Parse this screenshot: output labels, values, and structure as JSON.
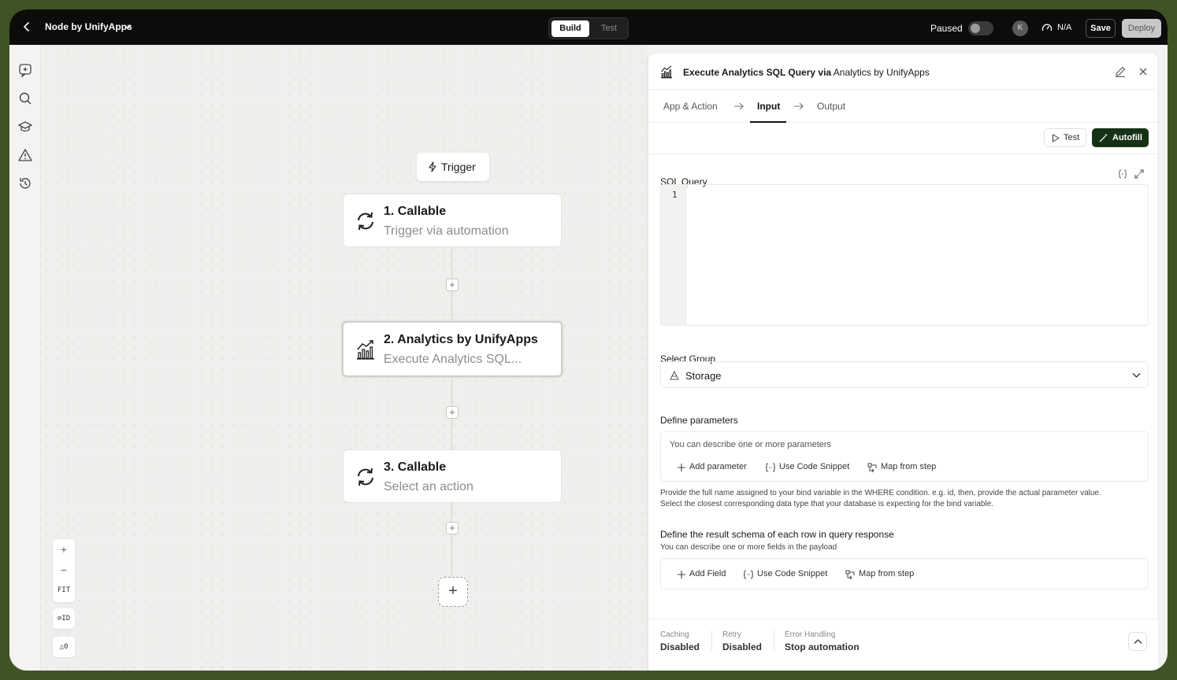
{
  "topbar": {
    "title": "Node by UnifyApps",
    "tabs": {
      "build": "Build",
      "test": "Test"
    },
    "paused_label": "Paused",
    "avatar_initial": "K",
    "speed_label": "N/A",
    "save_label": "Save",
    "deploy_label": "Deploy"
  },
  "canvas": {
    "trigger_label": "Trigger",
    "nodes": [
      {
        "title": "1. Callable",
        "subtitle": "Trigger via automation"
      },
      {
        "title": "2. Analytics by UnifyApps",
        "subtitle": "Execute Analytics SQL..."
      },
      {
        "title": "3. Callable",
        "subtitle": "Select an action"
      }
    ],
    "zoom": {
      "in": "+",
      "out": "−",
      "fit": "FIT"
    },
    "id_toggle": "ID",
    "warning_count": "0"
  },
  "panel": {
    "title_prefix": "Execute Analytics SQL Query via",
    "title_suffix": "Analytics by UnifyApps",
    "tabs": [
      "App & Action",
      "Input",
      "Output"
    ],
    "test_label": "Test",
    "autofill_label": "Autofill",
    "sql_query_label": "SQL Query",
    "sql_line_number": "1",
    "select_group_label": "Select Group",
    "select_group_value": "Storage",
    "define_params_label": "Define parameters",
    "params_hint": "You can describe one or more parameters",
    "params_actions": [
      "Add parameter",
      "Use Code Snippet",
      "Map from step"
    ],
    "params_help_1": "Provide the full name assigned to your bind variable in the WHERE condition. e.g. id, then, provide the actual parameter value.",
    "params_help_2": "Select the closest corresponding data type that your database is expecting for the bind variable.",
    "schema_label": "Define the result schema of each row in query response",
    "schema_hint": "You can describe one or more fields in the payload",
    "schema_actions": [
      "Add Field",
      "Use Code Snippet",
      "Map from step"
    ],
    "footer": [
      {
        "label": "Caching",
        "value": "Disabled"
      },
      {
        "label": "Retry",
        "value": "Disabled"
      },
      {
        "label": "Error Handling",
        "value": "Stop automation"
      }
    ]
  },
  "colors": {
    "accent": "#163216",
    "topbar": "#0c0c0c",
    "outer": "#3f5424"
  }
}
